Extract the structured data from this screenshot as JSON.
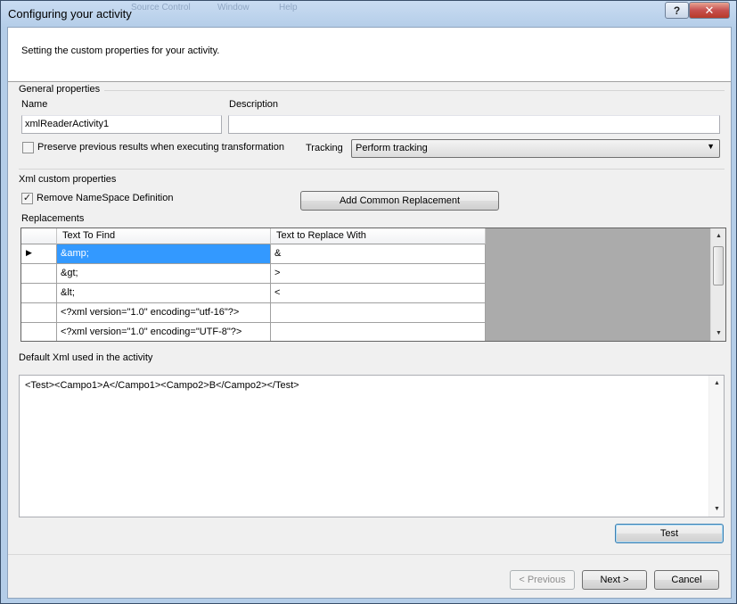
{
  "window": {
    "title": "Configuring your activity",
    "ghost_tabs": [
      "Source Control",
      "Window",
      "Help"
    ],
    "help_label": "?",
    "close_label": "✕"
  },
  "header": {
    "text": "Setting the custom properties for your activity."
  },
  "general": {
    "title": "General properties",
    "name_label": "Name",
    "name_value": "xmlReaderActivity1",
    "description_label": "Description",
    "description_value": "",
    "preserve_label": "Preserve previous results when executing transformation",
    "preserve_checked": false,
    "tracking_label": "Tracking",
    "tracking_value": "Perform tracking"
  },
  "xml_custom": {
    "title": "Xml custom properties",
    "remove_ns_label": "Remove NameSpace Definition",
    "remove_ns_checked": true,
    "add_replacement_label": "Add Common Replacement",
    "replacements_label": "Replacements",
    "columns": [
      "Text To Find",
      "Text to Replace With"
    ],
    "rows": [
      {
        "find": "&amp;",
        "replace": "&"
      },
      {
        "find": "&gt;",
        "replace": ">"
      },
      {
        "find": "&lt;",
        "replace": "<"
      },
      {
        "find": "<?xml version=\"1.0\" encoding=\"utf-16\"?>",
        "replace": ""
      },
      {
        "find": "<?xml version=\"1.0\" encoding=\"UTF-8\"?>",
        "replace": ""
      }
    ]
  },
  "default_xml": {
    "label": "Default Xml used in the activity",
    "value": "<Test><Campo1>A</Campo1><Campo2>B</Campo2></Test>"
  },
  "buttons": {
    "test": "Test",
    "previous": "< Previous",
    "next": "Next >",
    "cancel": "Cancel"
  }
}
